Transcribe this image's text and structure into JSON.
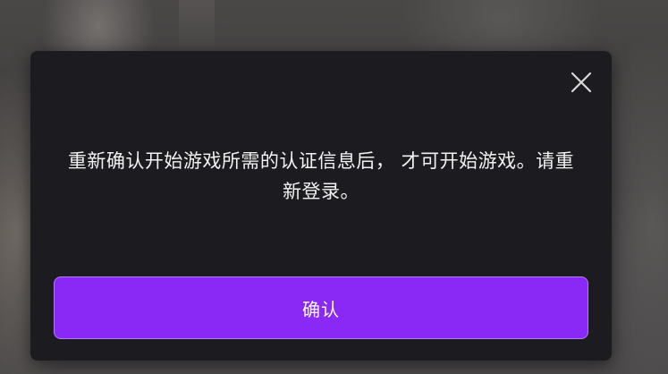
{
  "dialog": {
    "message": "重新确认开始游戏所需的认证信息后， 才可开始游戏。请重新登录。",
    "confirm_label": "确认",
    "close_icon": "close-icon"
  },
  "colors": {
    "dialog_bg": "#1c1b20",
    "accent": "#8a28f5",
    "accent_border": "#b27bff",
    "text": "#f2f2f2"
  }
}
